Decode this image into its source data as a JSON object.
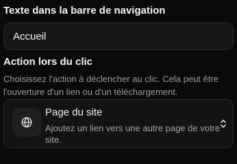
{
  "nav_text": {
    "label": "Texte dans la barre de navigation",
    "value": "Accueil"
  },
  "click_action": {
    "label": "Action lors du clic",
    "help": "Choisissez l'action à déclencher au clic. Cela peut être l'ouverture d'un lien ou d'un téléchargement.",
    "selected": {
      "icon": "globe-icon",
      "title": "Page du site",
      "description": "Ajoutez un lien vers une autre page de votre site."
    }
  }
}
